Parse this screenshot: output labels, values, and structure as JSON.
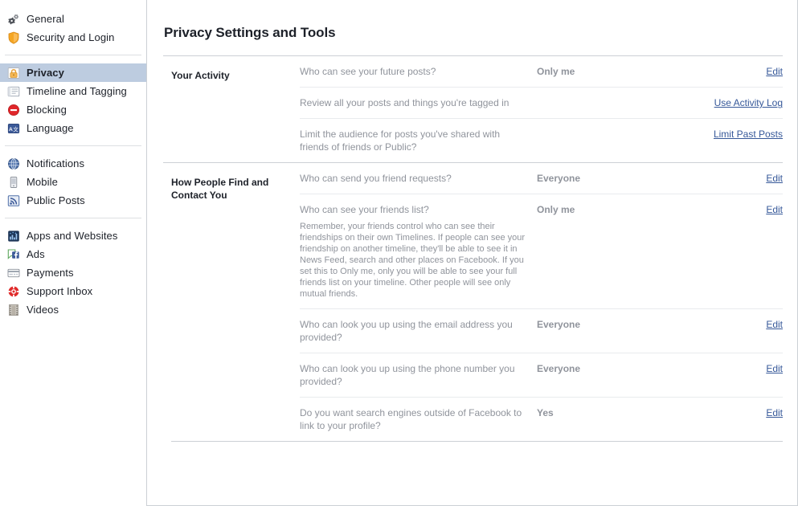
{
  "sidebar": {
    "groups": [
      {
        "items": [
          {
            "label": "General",
            "icon": "gears-icon",
            "selected": false
          },
          {
            "label": "Security and Login",
            "icon": "shield-icon",
            "selected": false
          }
        ]
      },
      {
        "items": [
          {
            "label": "Privacy",
            "icon": "lock-icon",
            "selected": true
          },
          {
            "label": "Timeline and Tagging",
            "icon": "timeline-icon",
            "selected": false
          },
          {
            "label": "Blocking",
            "icon": "block-icon",
            "selected": false
          },
          {
            "label": "Language",
            "icon": "language-icon",
            "selected": false
          }
        ]
      },
      {
        "items": [
          {
            "label": "Notifications",
            "icon": "globe-icon",
            "selected": false
          },
          {
            "label": "Mobile",
            "icon": "mobile-icon",
            "selected": false
          },
          {
            "label": "Public Posts",
            "icon": "rss-icon",
            "selected": false
          }
        ]
      },
      {
        "items": [
          {
            "label": "Apps and Websites",
            "icon": "apps-icon",
            "selected": false
          },
          {
            "label": "Ads",
            "icon": "ads-icon",
            "selected": false
          },
          {
            "label": "Payments",
            "icon": "card-icon",
            "selected": false
          },
          {
            "label": "Support Inbox",
            "icon": "lifering-icon",
            "selected": false
          },
          {
            "label": "Videos",
            "icon": "film-icon",
            "selected": false
          }
        ]
      }
    ]
  },
  "main": {
    "title": "Privacy Settings and Tools",
    "sections": [
      {
        "title": "Your Activity",
        "rows": [
          {
            "question": "Who can see your future posts?",
            "note": "",
            "value": "Only me",
            "action": "Edit"
          },
          {
            "question": "Review all your posts and things you're tagged in",
            "note": "",
            "value": "",
            "action": "Use Activity Log"
          },
          {
            "question": "Limit the audience for posts you've shared with friends of friends or Public?",
            "note": "",
            "value": "",
            "action": "Limit Past Posts"
          }
        ]
      },
      {
        "title": "How People Find and Contact You",
        "rows": [
          {
            "question": "Who can send you friend requests?",
            "note": "",
            "value": "Everyone",
            "action": "Edit"
          },
          {
            "question": "Who can see your friends list?",
            "note": "Remember, your friends control who can see their friendships on their own Timelines. If people can see your friendship on another timeline, they'll be able to see it in News Feed, search and other places on Facebook. If you set this to Only me, only you will be able to see your full friends list on your timeline. Other people will see only mutual friends.",
            "value": "Only me",
            "action": "Edit"
          },
          {
            "question": "Who can look you up using the email address you provided?",
            "note": "",
            "value": "Everyone",
            "action": "Edit"
          },
          {
            "question": "Who can look you up using the phone number you provided?",
            "note": "",
            "value": "Everyone",
            "action": "Edit"
          },
          {
            "question": "Do you want search engines outside of Facebook to link to your profile?",
            "note": "",
            "value": "Yes",
            "action": "Edit"
          }
        ]
      }
    ]
  },
  "colors": {
    "link": "#365899",
    "muted": "#90949c",
    "text": "#1d2129",
    "selected_bg": "#bdcce0",
    "border": "#ccd0d5",
    "row_border": "#e9ebee"
  }
}
